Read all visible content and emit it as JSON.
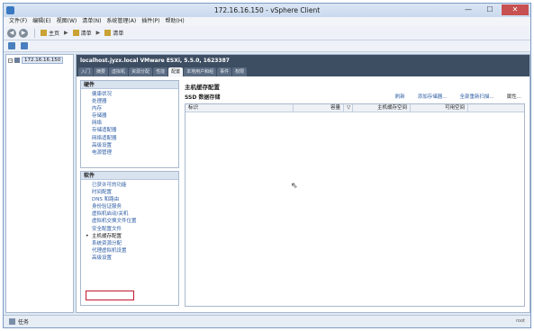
{
  "window": {
    "title": "172.16.16.150 - vSphere Client",
    "min_glyph": "—",
    "max_glyph": "☐",
    "close_glyph": "✕"
  },
  "menu": [
    "文件(F)",
    "编辑(E)",
    "视图(W)",
    "清单(N)",
    "系统管理(A)",
    "插件(P)",
    "帮助(H)"
  ],
  "toolbar": {
    "back_glyph": "◀",
    "forward_glyph": "▶",
    "breadcrumb": [
      "主页",
      "清单",
      "清单"
    ],
    "arrow_glyph": "▶"
  },
  "tree": {
    "expander": "−",
    "host_label": "172.16.16.150"
  },
  "host": {
    "header": "localhost.jyzx.local VMware ESXi, 5.5.0, 1623387",
    "tabs": [
      "入门",
      "摘要",
      "虚拟机",
      "资源分配",
      "性能",
      "配置",
      "本地用户和组",
      "事件",
      "权限"
    ],
    "active_tab_index": 5
  },
  "hardware": {
    "title": "硬件",
    "items": [
      "健康状况",
      "处理器",
      "内存",
      "存储器",
      "网络",
      "存储适配器",
      "网络适配器",
      "高级设置",
      "电源管理"
    ]
  },
  "software": {
    "title": "软件",
    "items": [
      "已获许可的功能",
      "时间配置",
      "DNS 和路由",
      "身份验证服务",
      "虚拟机启动/关机",
      "虚拟机交换文件位置",
      "安全配置文件",
      "主机缓存配置",
      "系统资源分配",
      "代理虚拟机设置",
      "高级设置"
    ],
    "selected_index": 7,
    "bullet": "•"
  },
  "content": {
    "title": "主机缓存配置",
    "subtitle": "SSD 数据存储",
    "actions": [
      "刷新",
      "添加存储器...",
      "全部重新扫描...",
      "属性..."
    ],
    "columns": [
      "标识",
      "容量",
      "▽",
      "主机缓存空间",
      "可用空间",
      ""
    ]
  },
  "status": {
    "label": "任务",
    "right": "root"
  },
  "colors": {
    "accent": "#2b5ba3",
    "header_bg": "#3d4d62",
    "highlight_box": "#c0182f"
  }
}
